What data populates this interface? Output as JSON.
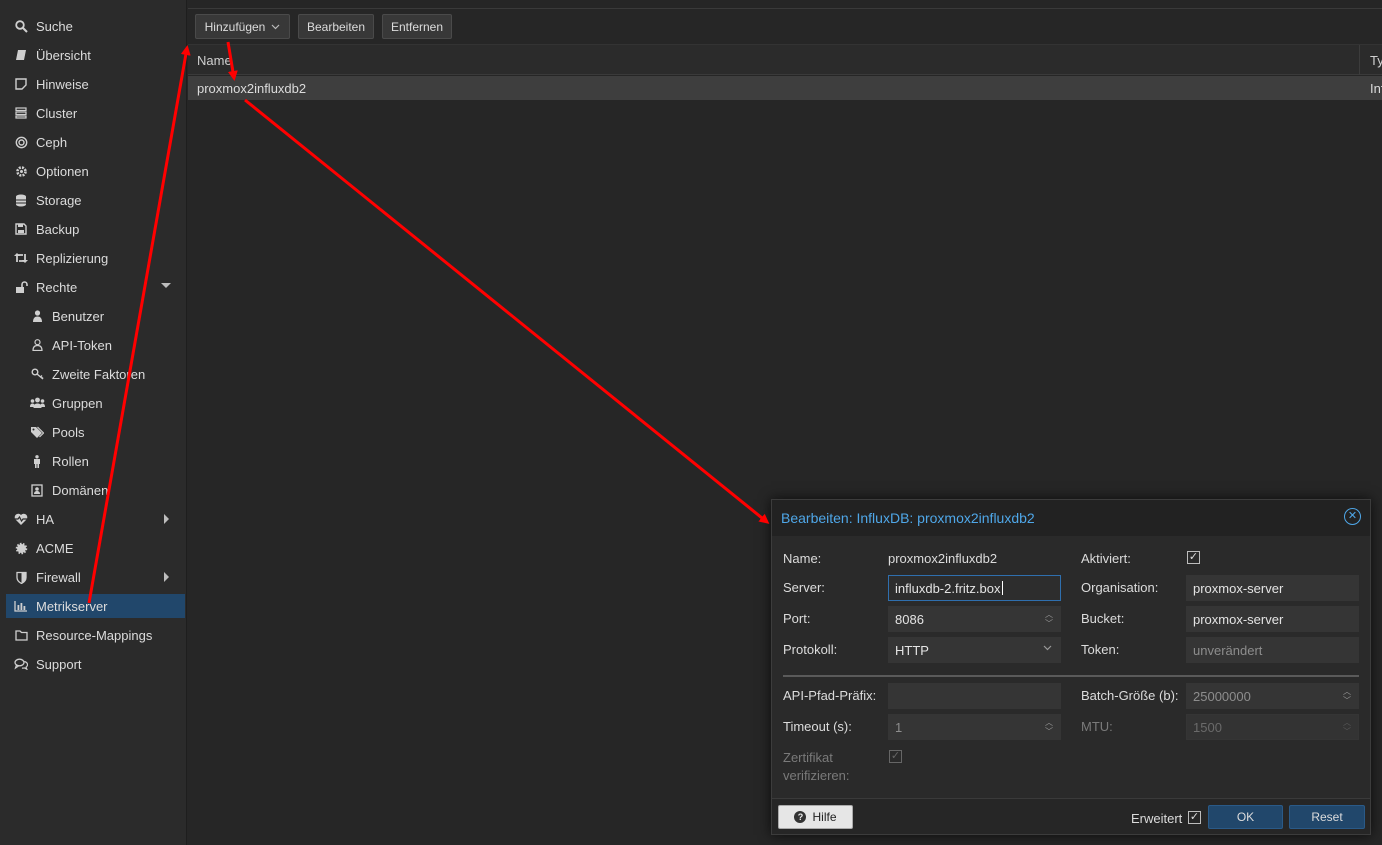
{
  "sidebar": {
    "items": [
      {
        "label": "Suche",
        "icon": "search-icon"
      },
      {
        "label": "Übersicht",
        "icon": "book-icon"
      },
      {
        "label": "Hinweise",
        "icon": "note-icon"
      },
      {
        "label": "Cluster",
        "icon": "server-icon"
      },
      {
        "label": "Ceph",
        "icon": "ceph-icon"
      },
      {
        "label": "Optionen",
        "icon": "gear-icon"
      },
      {
        "label": "Storage",
        "icon": "database-icon"
      },
      {
        "label": "Backup",
        "icon": "floppy-icon"
      },
      {
        "label": "Replizierung",
        "icon": "retweet-icon"
      },
      {
        "label": "Rechte",
        "icon": "unlock-icon"
      },
      {
        "label": "Benutzer",
        "icon": "user-icon"
      },
      {
        "label": "API-Token",
        "icon": "user-outline-icon"
      },
      {
        "label": "Zweite Faktoren",
        "icon": "key-icon"
      },
      {
        "label": "Gruppen",
        "icon": "users-icon"
      },
      {
        "label": "Pools",
        "icon": "tags-icon"
      },
      {
        "label": "Rollen",
        "icon": "male-icon"
      },
      {
        "label": "Domänen",
        "icon": "address-book-icon"
      },
      {
        "label": "HA",
        "icon": "heartbeat-icon"
      },
      {
        "label": "ACME",
        "icon": "certificate-icon"
      },
      {
        "label": "Firewall",
        "icon": "shield-icon"
      },
      {
        "label": "Metrikserver",
        "icon": "bar-chart-icon"
      },
      {
        "label": "Resource-Mappings",
        "icon": "folder-icon"
      },
      {
        "label": "Support",
        "icon": "comments-icon"
      }
    ]
  },
  "toolbar": {
    "add_label": "Hinzufügen",
    "edit_label": "Bearbeiten",
    "remove_label": "Entfernen"
  },
  "grid": {
    "columns": [
      "Name",
      "Ty"
    ],
    "rows": [
      {
        "name": "proxmox2influxdb2",
        "type": "Inf"
      }
    ]
  },
  "dialog": {
    "title": "Bearbeiten: InfluxDB: proxmox2influxdb2",
    "fields": {
      "name_label": "Name:",
      "name_value": "proxmox2influxdb2",
      "enabled_label": "Aktiviert:",
      "server_label": "Server:",
      "server_value": "influxdb-2.fritz.box",
      "org_label": "Organisation:",
      "org_value": "proxmox-server",
      "port_label": "Port:",
      "port_value": "8086",
      "bucket_label": "Bucket:",
      "bucket_value": "proxmox-server",
      "protocol_label": "Protokoll:",
      "protocol_value": "HTTP",
      "token_label": "Token:",
      "token_placeholder": "unverändert",
      "api_prefix_label": "API-Pfad-Präfix:",
      "batch_label": "Batch-Größe (b):",
      "batch_placeholder": "25000000",
      "timeout_label": "Timeout (s):",
      "timeout_placeholder": "1",
      "mtu_label": "MTU:",
      "mtu_placeholder": "1500",
      "verify_label_1": "Zertifikat",
      "verify_label_2": "verifizieren:"
    },
    "footer": {
      "help_label": "Hilfe",
      "advanced_label": "Erweitert",
      "ok_label": "OK",
      "reset_label": "Reset"
    }
  },
  "colors": {
    "accent": "#4fa7e8",
    "selected": "#21476b",
    "annotation_arrow": "#ff0000"
  }
}
